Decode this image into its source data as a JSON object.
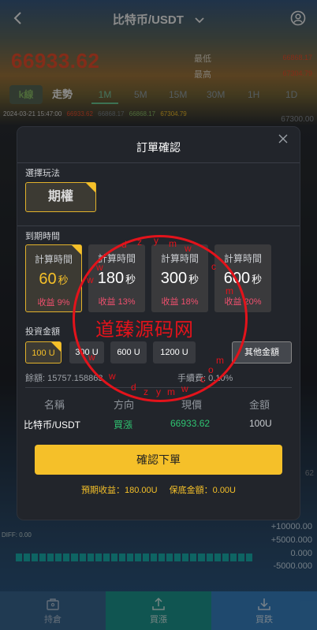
{
  "header": {
    "title": "比特币/USDT"
  },
  "quote": {
    "last_price": "66933.62",
    "low_label": "最低",
    "low_value": "66868.17",
    "high_label": "最高",
    "high_value": "67304.79"
  },
  "chart_tabs": {
    "kline": "k線",
    "trend": "走勢",
    "items": [
      "1M",
      "5M",
      "15M",
      "30M",
      "1H",
      "1D"
    ]
  },
  "info_bar": {
    "time": "2024-03-21 15:47:00",
    "open": "66933.62",
    "b": "66868.17",
    "c": "66868.17",
    "d": "67304.79"
  },
  "price_axis": {
    "top": "67300.00",
    "mid": "62"
  },
  "diff": {
    "label": "DIFF: 0.00"
  },
  "macd_axis": [
    "+10000.00",
    "+5000.000",
    "0.000",
    "-5000.000"
  ],
  "bottom_nav": {
    "hold": "持倉",
    "up": "買漲",
    "down": "買跌"
  },
  "modal": {
    "title": "訂單確認",
    "play_label": "選擇玩法",
    "play_option": "期權",
    "expiry_label": "到期時間",
    "time_options": [
      {
        "label": "計算時間",
        "value": "60",
        "unit": "秒",
        "yield": "收益 9%",
        "selected": true
      },
      {
        "label": "計算時間",
        "value": "180",
        "unit": "秒",
        "yield": "收益 13%",
        "selected": false
      },
      {
        "label": "計算時間",
        "value": "300",
        "unit": "秒",
        "yield": "收益 18%",
        "selected": false
      },
      {
        "label": "計算時間",
        "value": "600",
        "unit": "秒",
        "yield": "收益 20%",
        "selected": false
      }
    ],
    "amount_label": "投資金額",
    "amount_options": [
      "100 U",
      "300 U",
      "600 U",
      "1200 U"
    ],
    "amount_other": "其他金額",
    "balance": "餘額: 15757.158863",
    "fee": "手續費: 0.10%",
    "table_headers": [
      "名稱",
      "方向",
      "現價",
      "金額"
    ],
    "table_row": {
      "name": "比特币/USDT",
      "direction": "買漲",
      "price": "66933.62",
      "amount": "100U"
    },
    "confirm_button": "確認下單",
    "footer": {
      "expected": "預期收益：180.00U",
      "margin": "保底金額：0.00U"
    }
  },
  "watermark": {
    "text": "道臻源码网"
  },
  "colors": {
    "accent": "#f5c029",
    "down": "#f0502e",
    "up": "#2fc471"
  }
}
